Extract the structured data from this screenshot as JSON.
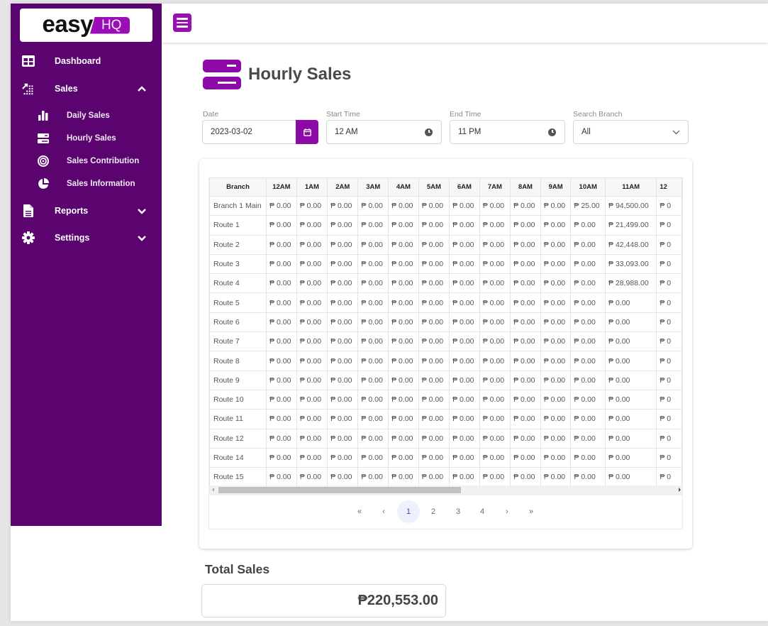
{
  "brand": {
    "name_part1": "easy",
    "name_part2": "HQ",
    "accent": "#8e0aa8",
    "sidebar_bg": "#5b0470"
  },
  "sidebar": {
    "items": [
      {
        "label": "Dashboard",
        "icon": "dashboard-icon"
      },
      {
        "label": "Sales",
        "icon": "sales-icon",
        "expanded": true,
        "children": [
          {
            "label": "Daily Sales",
            "icon": "bar-chart-icon"
          },
          {
            "label": "Hourly Sales",
            "icon": "server-icon"
          },
          {
            "label": "Sales Contribution",
            "icon": "target-icon"
          },
          {
            "label": "Sales Information",
            "icon": "pie-chart-icon"
          }
        ]
      },
      {
        "label": "Reports",
        "icon": "file-icon",
        "expanded": false
      },
      {
        "label": "Settings",
        "icon": "gear-icon",
        "expanded": false
      }
    ]
  },
  "header": {
    "title": "Hourly Sales"
  },
  "filters": {
    "date": {
      "label": "Date",
      "value": "2023-03-02"
    },
    "start_time": {
      "label": "Start Time",
      "value": "12 AM"
    },
    "end_time": {
      "label": "End Time",
      "value": "11 PM"
    },
    "branch": {
      "label": "Search Branch",
      "value": "All"
    }
  },
  "table": {
    "columns": [
      "Branch",
      "12AM",
      "1AM",
      "2AM",
      "3AM",
      "4AM",
      "5AM",
      "6AM",
      "7AM",
      "8AM",
      "9AM",
      "10AM",
      "11AM",
      "12"
    ],
    "rows": [
      {
        "branch": "Branch 1 Main",
        "values": [
          "₱ 0.00",
          "₱ 0.00",
          "₱ 0.00",
          "₱ 0.00",
          "₱ 0.00",
          "₱ 0.00",
          "₱ 0.00",
          "₱ 0.00",
          "₱ 0.00",
          "₱ 0.00",
          "₱ 25.00",
          "₱ 94,500.00",
          "₱ 0"
        ]
      },
      {
        "branch": "Route 1",
        "values": [
          "₱ 0.00",
          "₱ 0.00",
          "₱ 0.00",
          "₱ 0.00",
          "₱ 0.00",
          "₱ 0.00",
          "₱ 0.00",
          "₱ 0.00",
          "₱ 0.00",
          "₱ 0.00",
          "₱ 0.00",
          "₱ 21,499.00",
          "₱ 0"
        ]
      },
      {
        "branch": "Route 2",
        "values": [
          "₱ 0.00",
          "₱ 0.00",
          "₱ 0.00",
          "₱ 0.00",
          "₱ 0.00",
          "₱ 0.00",
          "₱ 0.00",
          "₱ 0.00",
          "₱ 0.00",
          "₱ 0.00",
          "₱ 0.00",
          "₱ 42,448.00",
          "₱ 0"
        ]
      },
      {
        "branch": "Route 3",
        "values": [
          "₱ 0.00",
          "₱ 0.00",
          "₱ 0.00",
          "₱ 0.00",
          "₱ 0.00",
          "₱ 0.00",
          "₱ 0.00",
          "₱ 0.00",
          "₱ 0.00",
          "₱ 0.00",
          "₱ 0.00",
          "₱ 33,093.00",
          "₱ 0"
        ]
      },
      {
        "branch": "Route 4",
        "values": [
          "₱ 0.00",
          "₱ 0.00",
          "₱ 0.00",
          "₱ 0.00",
          "₱ 0.00",
          "₱ 0.00",
          "₱ 0.00",
          "₱ 0.00",
          "₱ 0.00",
          "₱ 0.00",
          "₱ 0.00",
          "₱ 28,988.00",
          "₱ 0"
        ]
      },
      {
        "branch": "Route 5",
        "values": [
          "₱ 0.00",
          "₱ 0.00",
          "₱ 0.00",
          "₱ 0.00",
          "₱ 0.00",
          "₱ 0.00",
          "₱ 0.00",
          "₱ 0.00",
          "₱ 0.00",
          "₱ 0.00",
          "₱ 0.00",
          "₱ 0.00",
          "₱ 0"
        ]
      },
      {
        "branch": "Route 6",
        "values": [
          "₱ 0.00",
          "₱ 0.00",
          "₱ 0.00",
          "₱ 0.00",
          "₱ 0.00",
          "₱ 0.00",
          "₱ 0.00",
          "₱ 0.00",
          "₱ 0.00",
          "₱ 0.00",
          "₱ 0.00",
          "₱ 0.00",
          "₱ 0"
        ]
      },
      {
        "branch": "Route 7",
        "values": [
          "₱ 0.00",
          "₱ 0.00",
          "₱ 0.00",
          "₱ 0.00",
          "₱ 0.00",
          "₱ 0.00",
          "₱ 0.00",
          "₱ 0.00",
          "₱ 0.00",
          "₱ 0.00",
          "₱ 0.00",
          "₱ 0.00",
          "₱ 0"
        ]
      },
      {
        "branch": "Route 8",
        "values": [
          "₱ 0.00",
          "₱ 0.00",
          "₱ 0.00",
          "₱ 0.00",
          "₱ 0.00",
          "₱ 0.00",
          "₱ 0.00",
          "₱ 0.00",
          "₱ 0.00",
          "₱ 0.00",
          "₱ 0.00",
          "₱ 0.00",
          "₱ 0"
        ]
      },
      {
        "branch": "Route 9",
        "values": [
          "₱ 0.00",
          "₱ 0.00",
          "₱ 0.00",
          "₱ 0.00",
          "₱ 0.00",
          "₱ 0.00",
          "₱ 0.00",
          "₱ 0.00",
          "₱ 0.00",
          "₱ 0.00",
          "₱ 0.00",
          "₱ 0.00",
          "₱ 0"
        ]
      },
      {
        "branch": "Route 10",
        "values": [
          "₱ 0.00",
          "₱ 0.00",
          "₱ 0.00",
          "₱ 0.00",
          "₱ 0.00",
          "₱ 0.00",
          "₱ 0.00",
          "₱ 0.00",
          "₱ 0.00",
          "₱ 0.00",
          "₱ 0.00",
          "₱ 0.00",
          "₱ 0"
        ]
      },
      {
        "branch": "Route 11",
        "values": [
          "₱ 0.00",
          "₱ 0.00",
          "₱ 0.00",
          "₱ 0.00",
          "₱ 0.00",
          "₱ 0.00",
          "₱ 0.00",
          "₱ 0.00",
          "₱ 0.00",
          "₱ 0.00",
          "₱ 0.00",
          "₱ 0.00",
          "₱ 0"
        ]
      },
      {
        "branch": "Route 12",
        "values": [
          "₱ 0.00",
          "₱ 0.00",
          "₱ 0.00",
          "₱ 0.00",
          "₱ 0.00",
          "₱ 0.00",
          "₱ 0.00",
          "₱ 0.00",
          "₱ 0.00",
          "₱ 0.00",
          "₱ 0.00",
          "₱ 0.00",
          "₱ 0"
        ]
      },
      {
        "branch": "Route 14",
        "values": [
          "₱ 0.00",
          "₱ 0.00",
          "₱ 0.00",
          "₱ 0.00",
          "₱ 0.00",
          "₱ 0.00",
          "₱ 0.00",
          "₱ 0.00",
          "₱ 0.00",
          "₱ 0.00",
          "₱ 0.00",
          "₱ 0.00",
          "₱ 0"
        ]
      },
      {
        "branch": "Route 15",
        "values": [
          "₱ 0.00",
          "₱ 0.00",
          "₱ 0.00",
          "₱ 0.00",
          "₱ 0.00",
          "₱ 0.00",
          "₱ 0.00",
          "₱ 0.00",
          "₱ 0.00",
          "₱ 0.00",
          "₱ 0.00",
          "₱ 0.00",
          "₱ 0"
        ]
      }
    ]
  },
  "pagination": {
    "first": "«",
    "prev": "‹",
    "pages": [
      "1",
      "2",
      "3",
      "4"
    ],
    "current": "1",
    "next": "›",
    "last": "»"
  },
  "total": {
    "label": "Total Sales",
    "value": "₱220,553.00"
  }
}
